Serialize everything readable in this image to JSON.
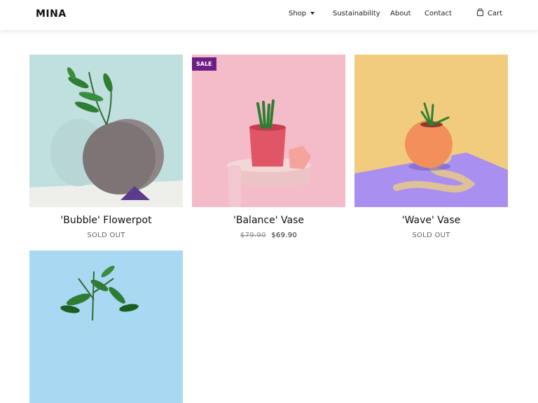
{
  "header": {
    "logo": "MINA",
    "nav": {
      "shop": "Shop",
      "sustainability": "Sustainability",
      "about": "About",
      "contact": "Contact",
      "cart": "Cart"
    }
  },
  "products": [
    {
      "title": "'Bubble' Flowerpot",
      "status": "SOLD OUT"
    },
    {
      "title": "'Balance' Vase",
      "badge": "SALE",
      "old_price": "$79.90",
      "price": "$69.90"
    },
    {
      "title": "'Wave' Vase",
      "status": "SOLD OUT"
    },
    {
      "title": ""
    }
  ],
  "icons": {
    "cart": "shopping-bag-icon",
    "shop_dropdown": "caret-down-icon"
  },
  "colors": {
    "badge": "#6e1f83"
  }
}
